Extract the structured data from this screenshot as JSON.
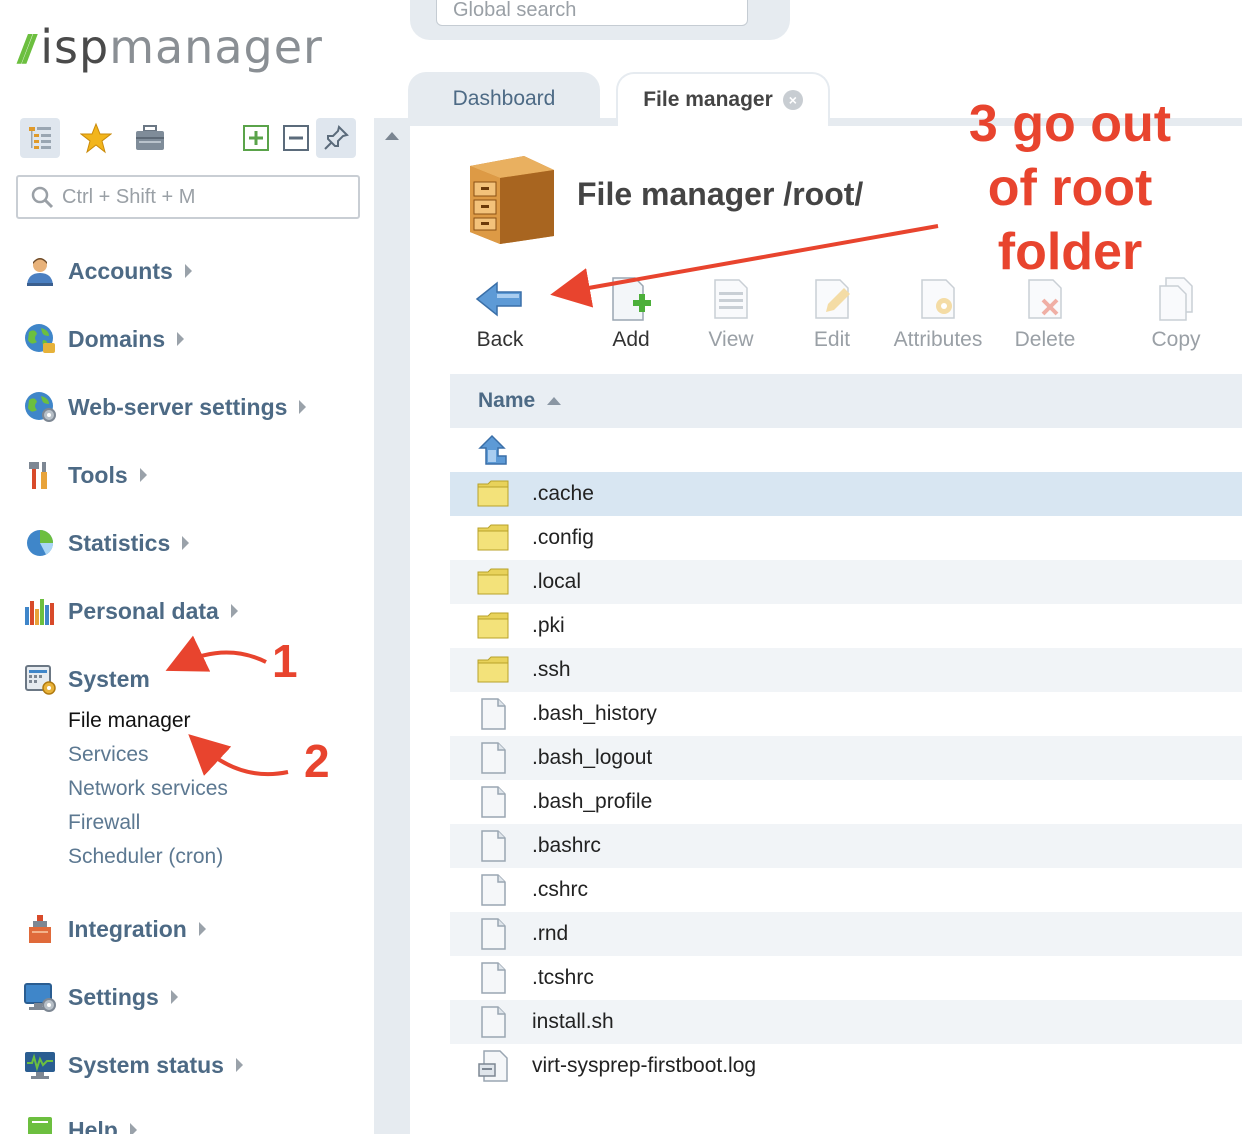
{
  "logo": {
    "isp": "isp",
    "manager": "manager"
  },
  "global_search": {
    "placeholder": "Global search"
  },
  "sidebar": {
    "search_placeholder": "Ctrl + Shift + M",
    "toolbar_icons": [
      "tree-view-icon",
      "favorites-star-icon",
      "briefcase-icon",
      "expand-all-icon",
      "collapse-all-icon",
      "pin-icon"
    ],
    "menu": [
      {
        "label": "Accounts",
        "icon": "accounts-icon"
      },
      {
        "label": "Domains",
        "icon": "domains-globe-icon"
      },
      {
        "label": "Web-server settings",
        "icon": "web-server-icon"
      },
      {
        "label": "Tools",
        "icon": "tools-icon"
      },
      {
        "label": "Statistics",
        "icon": "statistics-pie-icon"
      },
      {
        "label": "Personal data",
        "icon": "personal-data-chart-icon"
      },
      {
        "label": "System",
        "icon": "system-icon"
      },
      {
        "label": "Integration",
        "icon": "integration-icon"
      },
      {
        "label": "Settings",
        "icon": "settings-monitor-icon"
      },
      {
        "label": "System status",
        "icon": "system-status-icon"
      },
      {
        "label": "Help",
        "icon": "help-icon"
      }
    ],
    "system_submenu": [
      "File manager",
      "Services",
      "Network services",
      "Firewall",
      "Scheduler (cron)"
    ]
  },
  "tabs": [
    {
      "label": "Dashboard",
      "active": false
    },
    {
      "label": "File manager",
      "active": true
    }
  ],
  "page": {
    "title": "File manager /root/"
  },
  "toolbar": [
    {
      "label": "Back",
      "enabled": true,
      "icon": "back-arrow-icon"
    },
    {
      "label": "Add",
      "enabled": true,
      "icon": "add-file-icon"
    },
    {
      "label": "View",
      "enabled": false,
      "icon": "view-icon"
    },
    {
      "label": "Edit",
      "enabled": false,
      "icon": "edit-icon"
    },
    {
      "label": "Attributes",
      "enabled": false,
      "icon": "attributes-icon"
    },
    {
      "label": "Delete",
      "enabled": false,
      "icon": "delete-icon"
    },
    {
      "label": "Copy",
      "enabled": false,
      "icon": "copy-icon"
    }
  ],
  "table": {
    "column": "Name",
    "rows": [
      {
        "name": "",
        "type": "up"
      },
      {
        "name": ".cache",
        "type": "folder"
      },
      {
        "name": ".config",
        "type": "folder"
      },
      {
        "name": ".local",
        "type": "folder"
      },
      {
        "name": ".pki",
        "type": "folder"
      },
      {
        "name": ".ssh",
        "type": "folder"
      },
      {
        "name": ".bash_history",
        "type": "file"
      },
      {
        "name": ".bash_logout",
        "type": "file"
      },
      {
        "name": ".bash_profile",
        "type": "file"
      },
      {
        "name": ".bashrc",
        "type": "file"
      },
      {
        "name": ".cshrc",
        "type": "file"
      },
      {
        "name": ".rnd",
        "type": "file"
      },
      {
        "name": ".tcshrc",
        "type": "file"
      },
      {
        "name": "install.sh",
        "type": "file"
      },
      {
        "name": "virt-sysprep-firstboot.log",
        "type": "log"
      }
    ]
  },
  "annotations": {
    "step1": "1",
    "step2": "2",
    "step3_line1": "3 go out",
    "step3_line2": "of root",
    "step3_line3": "folder",
    "color": "#e8442e"
  }
}
